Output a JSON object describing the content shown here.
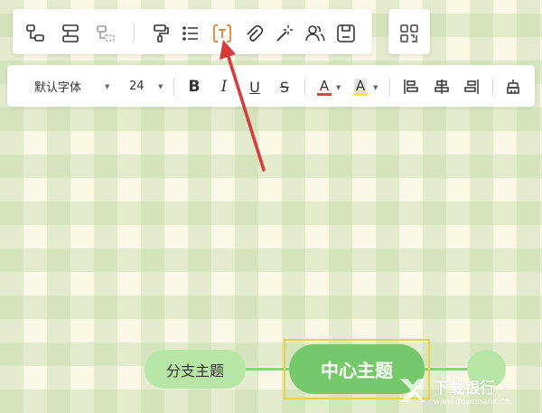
{
  "toolbar_top": {
    "icons": [
      {
        "name": "insert-child-topic-icon"
      },
      {
        "name": "insert-sibling-topic-icon"
      },
      {
        "name": "insert-floating-topic-icon"
      },
      {
        "name": "format-painter-icon"
      },
      {
        "name": "list-icon"
      },
      {
        "name": "text-box-icon",
        "accent": "#e07d2c"
      },
      {
        "name": "attachment-icon"
      },
      {
        "name": "magic-wand-icon"
      },
      {
        "name": "collaboration-icon"
      },
      {
        "name": "save-icon"
      }
    ],
    "qr_icon": "qr-code-icon"
  },
  "format_bar": {
    "font_family": "默认字体",
    "font_size": "24",
    "bold_label": "B",
    "italic_label": "I",
    "underline_label": "U",
    "strike_label": "S",
    "font_color_label": "A",
    "highlight_label": "A",
    "font_color": "#e0423d",
    "highlight_color": "#f0e94a"
  },
  "canvas": {
    "branch_topic": "分支主题",
    "central_topic": "中心主题"
  },
  "annotation": {
    "arrow_color": "#d8393b"
  },
  "watermark": {
    "title": "下载银行",
    "subtitle": "www.downbank.cn"
  }
}
